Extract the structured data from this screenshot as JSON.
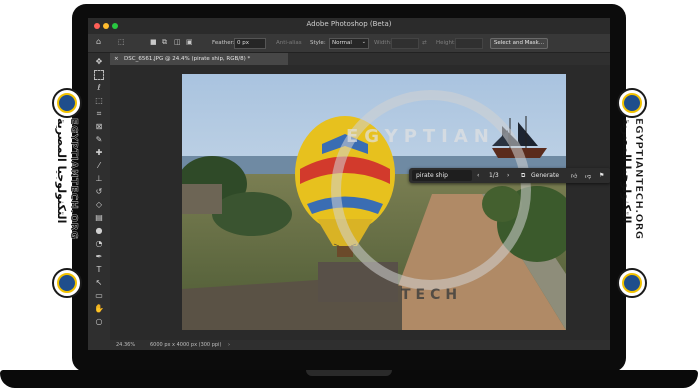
{
  "window": {
    "title": "Adobe Photoshop (Beta)"
  },
  "options_bar": {
    "feather_label": "Feather:",
    "feather_value": "0 px",
    "antialias_label": "Anti-alias",
    "style_label": "Style:",
    "style_value": "Normal",
    "width_label": "Width:",
    "height_label": "Height:",
    "select_mask_label": "Select and Mask..."
  },
  "document_tab": {
    "label": "DSC_6561.JPG @ 24.4% (pirate ship, RGB/8) *"
  },
  "status_bar": {
    "zoom": "24.36%",
    "doc_info": "6000 px x 4000 px (300 ppi)"
  },
  "generative_bar": {
    "prompt_value": "pirate ship",
    "variation_counter": "1/3",
    "generate_label": "Generate"
  },
  "watermark": {
    "top_text": "EGYPTIAN",
    "bottom_text": "TECH"
  },
  "side_branding": {
    "latin_text": "EGYPTIANTECH.ORG",
    "arabic_text": "التكنولوجيا المصرية"
  },
  "tools": [
    "move-tool",
    "marquee-tool",
    "lasso-tool",
    "object-select-tool",
    "crop-tool",
    "frame-tool",
    "eyedropper-tool",
    "healing-brush-tool",
    "brush-tool",
    "clone-stamp-tool",
    "history-brush-tool",
    "eraser-tool",
    "gradient-tool",
    "blur-tool",
    "dodge-tool",
    "pen-tool",
    "type-tool",
    "path-select-tool",
    "rectangle-tool",
    "hand-tool",
    "zoom-tool"
  ]
}
